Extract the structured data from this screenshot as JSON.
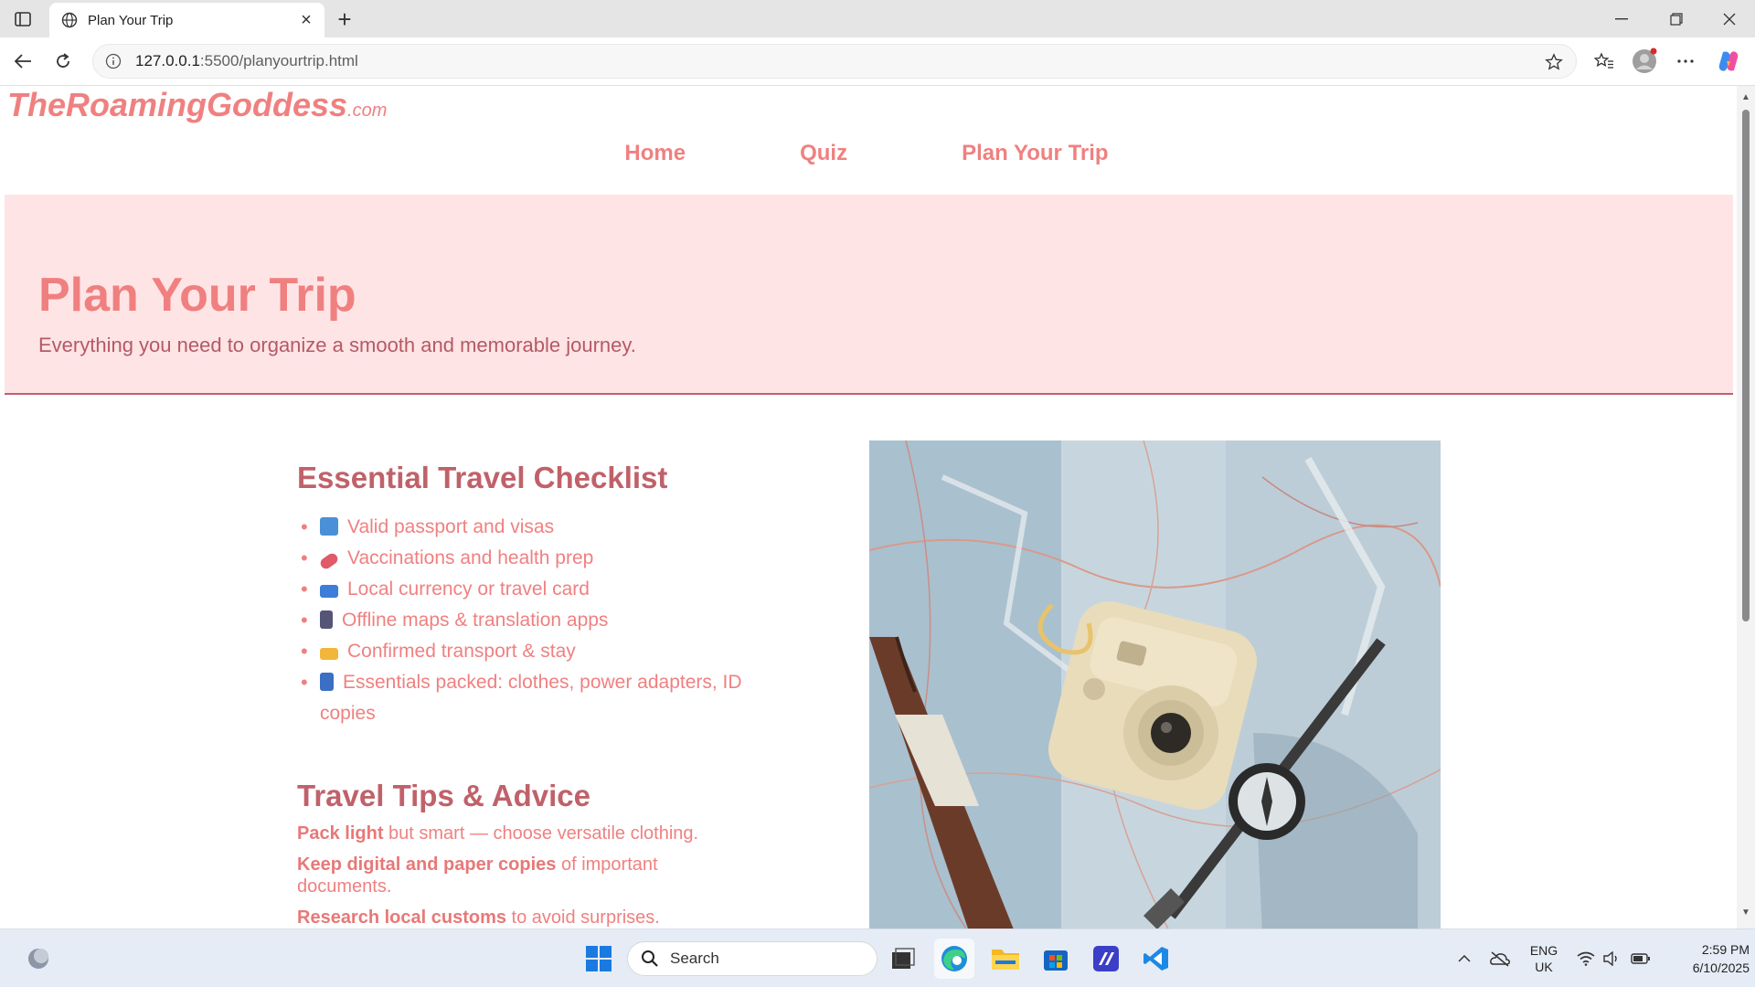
{
  "browser": {
    "tab_title": "Plan Your Trip",
    "url_host": "127.0.0.1",
    "url_path": ":5500/planyourtrip.html"
  },
  "site": {
    "brand_name": "TheRoamingGoddess",
    "brand_tld": ".com",
    "nav": [
      "Home",
      "Quiz",
      "Plan Your Trip"
    ]
  },
  "hero": {
    "title": "Plan Your Trip",
    "subtitle": "Everything you need to organize a smooth and memorable journey."
  },
  "checklist": {
    "title": "Essential Travel Checklist",
    "items": [
      {
        "icon": "passport-icon",
        "text": "Valid passport and visas",
        "color": "#4a90d9"
      },
      {
        "icon": "pill-icon",
        "text": "Vaccinations and health prep",
        "color": "#e05a6a"
      },
      {
        "icon": "credit-card-icon",
        "text": "Local currency or travel card",
        "color": "#3b7dd8"
      },
      {
        "icon": "mobile-phone-icon",
        "text": "Offline maps & translation apps",
        "color": "#555577"
      },
      {
        "icon": "ticket-icon",
        "text": "Confirmed transport & stay",
        "color": "#f2b63a"
      },
      {
        "icon": "luggage-icon",
        "text": "Essentials packed: clothes, power adapters, ID copies",
        "color": "#3a6fc4"
      }
    ]
  },
  "tips": {
    "title": "Travel Tips & Advice",
    "items": [
      {
        "bold": "Pack light",
        "rest": " but smart — choose versatile clothing."
      },
      {
        "bold": "Keep digital and paper copies",
        "rest": " of important documents."
      },
      {
        "bold": "Research local customs",
        "rest": " to avoid surprises."
      }
    ]
  },
  "taskbar": {
    "search_label": "Search",
    "lang_line1": "ENG",
    "lang_line2": "UK",
    "time": "2:59 PM",
    "date": "6/10/2025"
  },
  "colors": {
    "accent": "#f08080",
    "hero_bg": "#ffe4e6",
    "heading": "#c0616a"
  }
}
